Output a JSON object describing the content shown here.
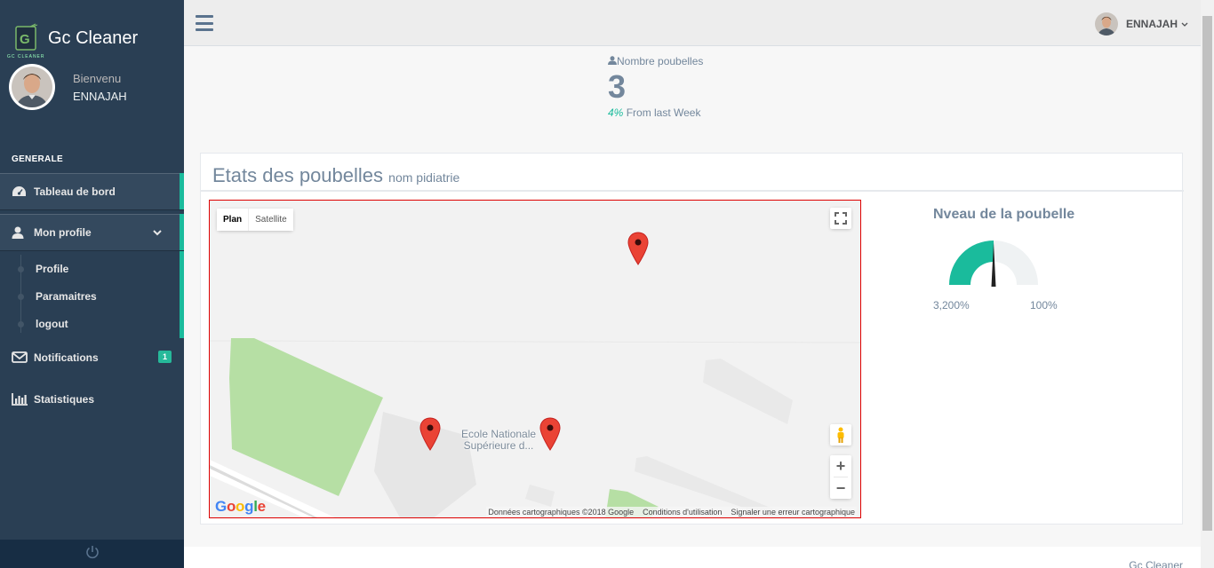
{
  "app": {
    "name": "Gc Cleaner",
    "logo_caption": "GC CLEANER"
  },
  "profile": {
    "welcome": "Bienvenu",
    "username": "ENNAJAH"
  },
  "sidebar": {
    "section_title": "GENERALE",
    "items": [
      {
        "label": "Tableau de bord",
        "icon": "dashboard-icon"
      },
      {
        "label": "Mon profile",
        "icon": "user-icon"
      },
      {
        "label": "Notifications",
        "icon": "envelope-icon",
        "badge": "1"
      },
      {
        "label": "Statistiques",
        "icon": "bar-chart-icon"
      }
    ],
    "submenu": [
      {
        "label": "Profile"
      },
      {
        "label": "Paramaitres"
      },
      {
        "label": "logout"
      }
    ]
  },
  "topnav": {
    "user": "ENNAJAH"
  },
  "stats": {
    "title": "Nombre poubelles",
    "count": "3",
    "change": "4%",
    "change_label": "From last Week"
  },
  "panel": {
    "title": "Etats des poubelles",
    "subtitle": "nom pidiatrie"
  },
  "map": {
    "type_plan": "Plan",
    "type_satellite": "Satellite",
    "poi_line1": "Ecole Nationale",
    "poi_line2": "Supérieure d...",
    "logo": "Google",
    "footer_data": "Données cartographiques ©2018 Google",
    "footer_terms": "Conditions d'utilisation",
    "footer_report": "Signaler une erreur cartographique",
    "marker_count": 3
  },
  "gauge": {
    "title": "Nveau de la poubelle",
    "min_label": "3,200%",
    "max_label": "100%",
    "fill_fraction": 0.5,
    "color_fill": "#1abb9c",
    "color_track": "#eff2f3"
  },
  "footer": {
    "text": "Gc Cleaner"
  },
  "colors": {
    "sidebar": "#2a3f54",
    "accent": "#1abb9c",
    "marker": "#ea4335"
  }
}
